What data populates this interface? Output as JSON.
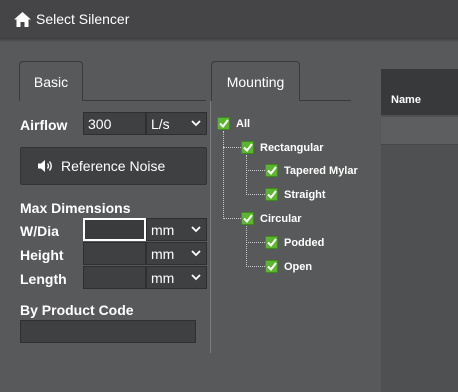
{
  "header": {
    "title": "Select Silencer",
    "icon": "home-icon"
  },
  "tabs": {
    "basic": "Basic",
    "mounting": "Mounting"
  },
  "basic": {
    "airflow_label": "Airflow",
    "airflow_value": "300",
    "airflow_unit": "L/s",
    "reference_noise_button": "Reference Noise",
    "max_dimensions_heading": "Max Dimensions",
    "wdia_label": "W/Dia",
    "wdia_value": "",
    "wdia_unit": "mm",
    "height_label": "Height",
    "height_value": "",
    "height_unit": "mm",
    "length_label": "Length",
    "length_value": "",
    "length_unit": "mm",
    "product_code_label": "By Product Code",
    "product_code_value": ""
  },
  "mounting": {
    "tree": {
      "all": "All",
      "rectangular": "Rectangular",
      "tapered_mylar": "Tapered Mylar",
      "straight": "Straight",
      "circular": "Circular",
      "podded": "Podded",
      "open": "Open"
    }
  },
  "results": {
    "columns": [
      "Name"
    ]
  },
  "colors": {
    "checkbox": "#5cb531",
    "background": "#58595b",
    "topbar": "#454547"
  }
}
